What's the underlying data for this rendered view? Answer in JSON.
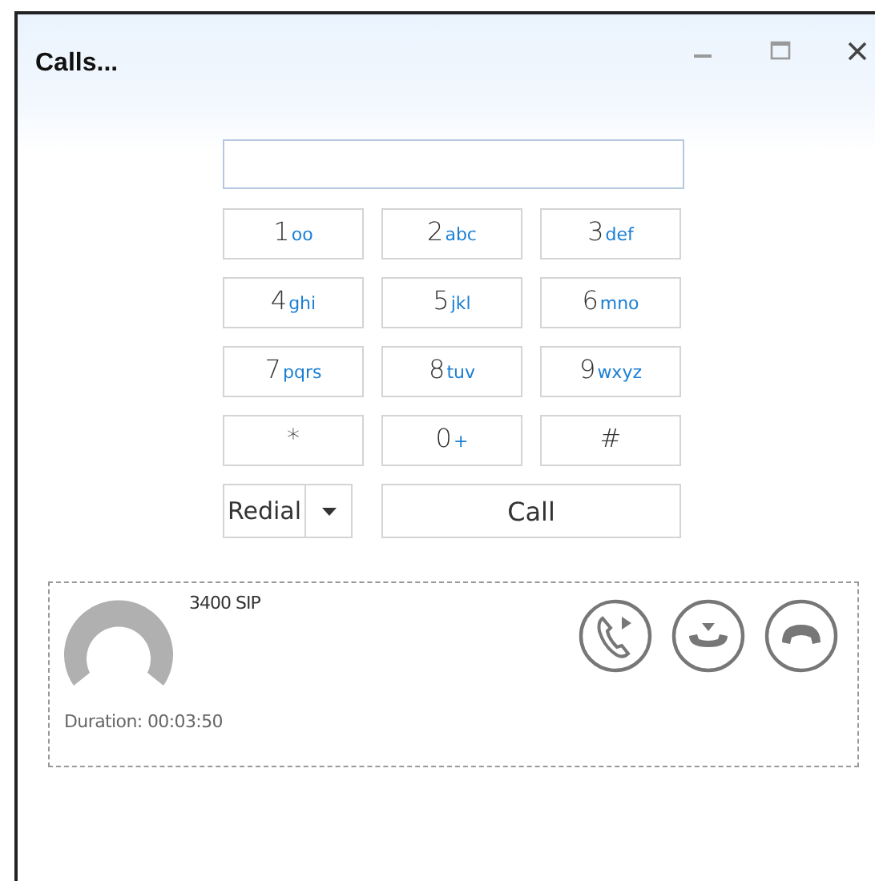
{
  "window": {
    "title": "Calls..."
  },
  "keypad": [
    {
      "digit": "1",
      "letters": "oo"
    },
    {
      "digit": "2",
      "letters": "abc"
    },
    {
      "digit": "3",
      "letters": "def"
    },
    {
      "digit": "4",
      "letters": "ghi"
    },
    {
      "digit": "5",
      "letters": "jkl"
    },
    {
      "digit": "6",
      "letters": "mno"
    },
    {
      "digit": "7",
      "letters": "pqrs"
    },
    {
      "digit": "8",
      "letters": "tuv"
    },
    {
      "digit": "9",
      "letters": "wxyz"
    },
    {
      "digit": "*"
    },
    {
      "digit": "0",
      "letters": "+"
    },
    {
      "digit": "#"
    }
  ],
  "redial_button": "Redial",
  "call_button": "Call",
  "active_call": {
    "name": "3400 SIP",
    "duration": "Duration: 00:03:50"
  }
}
